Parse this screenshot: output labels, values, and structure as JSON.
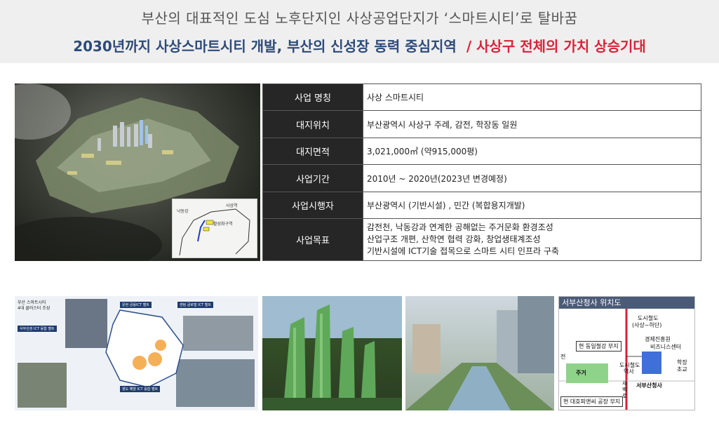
{
  "header": {
    "line1": "부산의 대표적인 도심 노후단지인 사상공업단지가 ‘스마트시티’로 탈바꿈",
    "line2_blue": "2030년까지 사상스마트시티 개발, 부산의 신성장 동력 중심지역",
    "line2_red": "/ 사상구 전체의 가치 상승기대"
  },
  "aerial_inset": {
    "label_left": "낙동강",
    "label_right": "사상역",
    "label_zone": "활성화구역"
  },
  "info_table": {
    "rows": [
      {
        "key": "사업 명칭",
        "value": "사상 스마트시티"
      },
      {
        "key": "대지위치",
        "value": "부산광역시 사상구 주례, 감전, 학장동 일원"
      },
      {
        "key": "대지면적",
        "value": "3,021,000㎡ (약915,000평)"
      },
      {
        "key": "사업기간",
        "value": "2010년 ~ 2020년(2023년 변경예정)"
      },
      {
        "key": "사업시행자",
        "value": "부산광역시 (기반시설) , 민간 (복합용지개발)"
      }
    ],
    "goal": {
      "key": "사업목표",
      "lines": [
        "감전천, 낙동강과 연계한 공해없는 주거문화 환경조성",
        "산업구조 개편, 산학연 협력 강화, 창업생태계조성",
        "기반시설에 ICT기술 접목으로 스마트 시티 인프라 구축"
      ]
    }
  },
  "cluster_image": {
    "title1": "부산 스마트시티",
    "title2": "4대 클러스터 조성",
    "box1": "서부산권 ICT 융합 벨트",
    "box2": "문현 금융ICT 벨트",
    "box3": "센텀 글로벌 ICT 벨트",
    "box4": "영도 해양 ICT 융합 벨트"
  },
  "location_map": {
    "title": "서부산청사 위치도",
    "label_subway": "도시철도",
    "label_subway_dir": "(사상~하단)",
    "label_steel": "현 동일철강 부지",
    "label_econ": "경제진흥원",
    "label_biz": "비즈니스센터",
    "label_station": "도시철도",
    "label_station2": "역사",
    "label_school": "학장",
    "label_school2": "초교",
    "label_residential": "주거",
    "label_new": "새",
    "label_road": "벽",
    "label_road2": "로",
    "label_office": "서부산청사",
    "label_factory": "현 대호피앤씨 공장 부지",
    "label_jeon": "전",
    "colors": {
      "title_bg": "#4a5b78",
      "site": "#3f6fd8",
      "rail": "#d8233a"
    }
  },
  "colors": {
    "header_blue": "#2e4a78",
    "header_red": "#d8233a",
    "table_key_bg": "#262626"
  }
}
